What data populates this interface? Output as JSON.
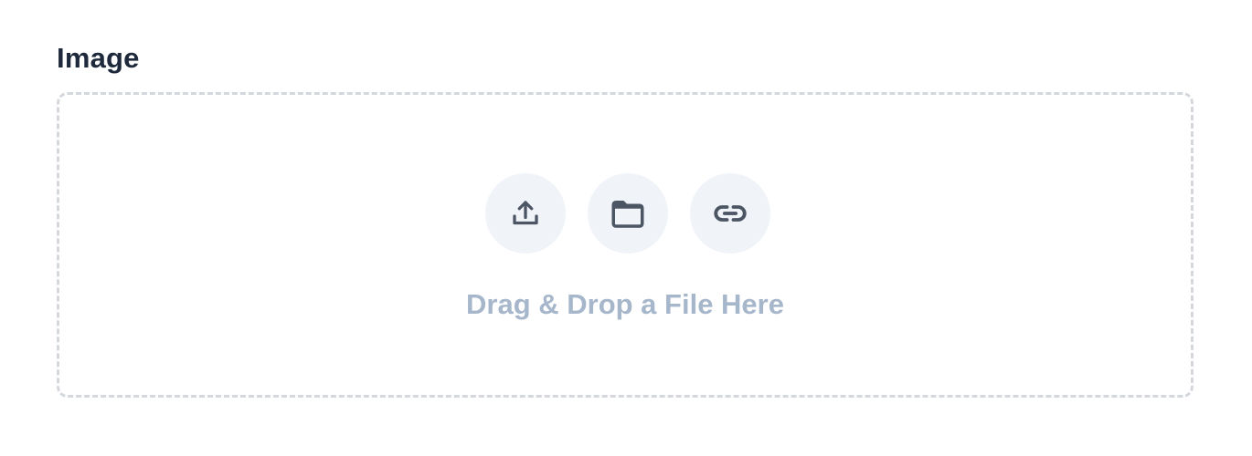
{
  "field": {
    "label": "Image"
  },
  "dropzone": {
    "hint": "Drag & Drop a File Here",
    "actions": [
      {
        "icon": "upload-icon"
      },
      {
        "icon": "folder-icon"
      },
      {
        "icon": "link-icon"
      }
    ]
  },
  "colors": {
    "label": "#1e293b",
    "hint": "#a7b7cb",
    "icon": "#4b5563",
    "icon_bg": "#f0f3f8",
    "border": "#d4d8dd"
  }
}
